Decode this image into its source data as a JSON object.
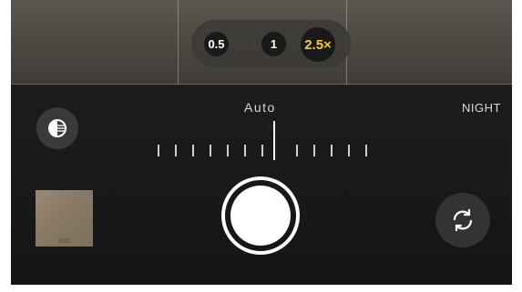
{
  "zoom": {
    "options": [
      "0.5",
      "1",
      "2.5×"
    ],
    "selected": "2.5×"
  },
  "modes": {
    "center": "Auto",
    "right": "NIGHT"
  },
  "thumbnail": {
    "caption": "BVD"
  },
  "icons": {
    "exposure": "exposure-icon",
    "shutter": "shutter-icon",
    "flip": "camera-flip-icon"
  },
  "colors": {
    "accent": "#f5cc2e",
    "background": "#111111"
  }
}
